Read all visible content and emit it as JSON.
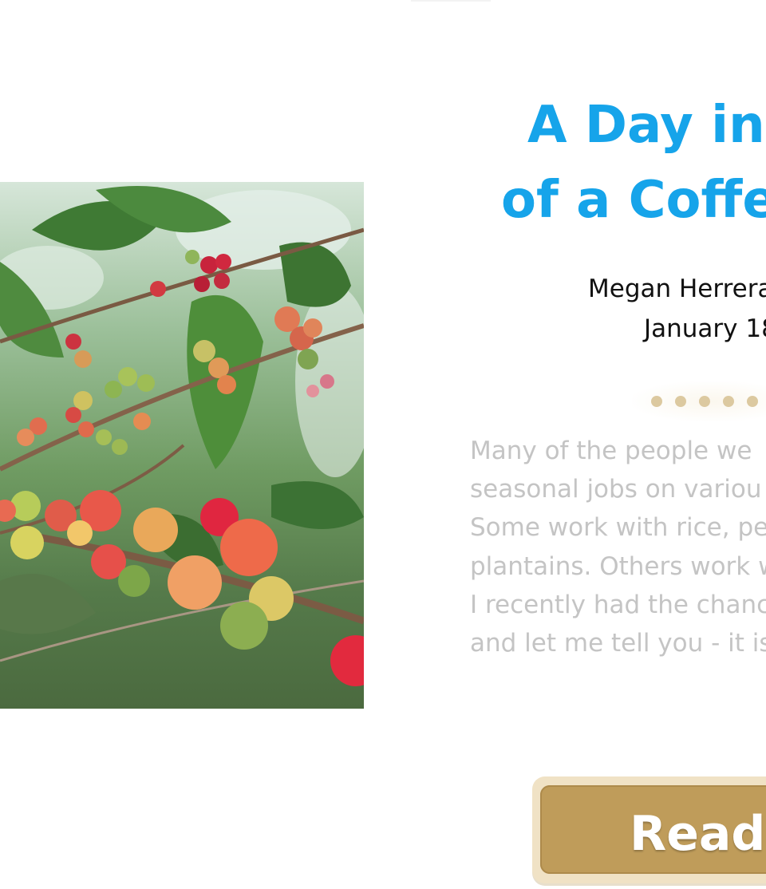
{
  "article": {
    "title_line1": "A Day in",
    "title_line2": "of a Coffe",
    "author": "Megan Herrera",
    "date": "January 18",
    "excerpt_lines": [
      "Many of the people we",
      "seasonal jobs on variou",
      "Some work with rice, pe",
      "plantains. Others work w",
      "I recently had the chanc",
      "and let me tell you - it is"
    ],
    "photo_icon": "coffee-cherries-photo"
  },
  "button": {
    "label": "Read I"
  },
  "colors": {
    "title": "#16a4ea",
    "excerpt": "#c4c4c4",
    "button": "#bf9c5a",
    "dots": "#dcc9a0"
  }
}
